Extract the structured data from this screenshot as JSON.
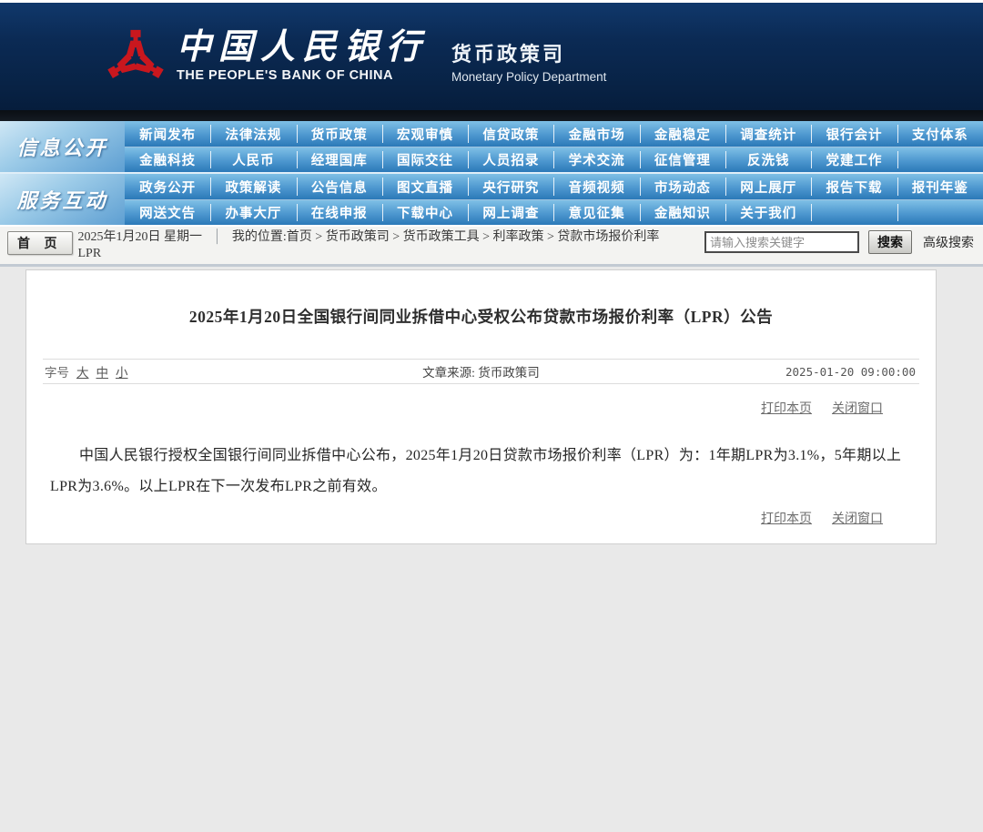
{
  "header": {
    "title_cn": "中国人民银行",
    "title_en": "THE PEOPLE'S BANK OF CHINA",
    "dept_cn": "货币政策司",
    "dept_en": "Monetary Policy Department",
    "logo_color": "#c9171e",
    "banner_color": "#0b2a54"
  },
  "nav": {
    "accent_color": "#2b79b8",
    "sections": [
      {
        "label": "信息公开",
        "rows": [
          [
            "新闻发布",
            "法律法规",
            "货币政策",
            "宏观审慎",
            "信贷政策",
            "金融市场",
            "金融稳定",
            "调查统计",
            "银行会计",
            "支付体系"
          ],
          [
            "金融科技",
            "人民币",
            "经理国库",
            "国际交往",
            "人员招录",
            "学术交流",
            "征信管理",
            "反洗钱",
            "党建工作",
            ""
          ]
        ]
      },
      {
        "label": "服务互动",
        "rows": [
          [
            "政务公开",
            "政策解读",
            "公告信息",
            "图文直播",
            "央行研究",
            "音频视频",
            "市场动态",
            "网上展厅",
            "报告下载",
            "报刊年鉴"
          ],
          [
            "网送文告",
            "办事大厅",
            "在线申报",
            "下载中心",
            "网上调查",
            "意见征集",
            "金融知识",
            "关于我们",
            "",
            ""
          ]
        ]
      }
    ]
  },
  "breadcrumb_bar": {
    "home_button": "首 页",
    "date": "2025年1月20日  星期一",
    "divider": "│",
    "location_line1": "我的位置:首页  >  货币政策司  >  货币政策工具  >  利率政策  >  贷款市场报价利率",
    "location_line2": "LPR",
    "search_placeholder": "请输入搜索关键字",
    "search_button": "搜索",
    "advanced_search": "高级搜索"
  },
  "article": {
    "title": "2025年1月20日全国银行间同业拆借中心受权公布贷款市场报价利率（LPR）公告",
    "font_size_label": "字号",
    "font_size_large": "大",
    "font_size_medium": "中",
    "font_size_small": "小",
    "source": "文章来源: 货币政策司",
    "datetime": "2025-01-20 09:00:00",
    "print_link": "打印本页",
    "close_link": "关闭窗口",
    "body": "中国人民银行授权全国银行间同业拆借中心公布，2025年1月20日贷款市场报价利率（LPR）为：1年期LPR为3.1%，5年期以上LPR为3.6%。以上LPR在下一次发布LPR之前有效。"
  }
}
